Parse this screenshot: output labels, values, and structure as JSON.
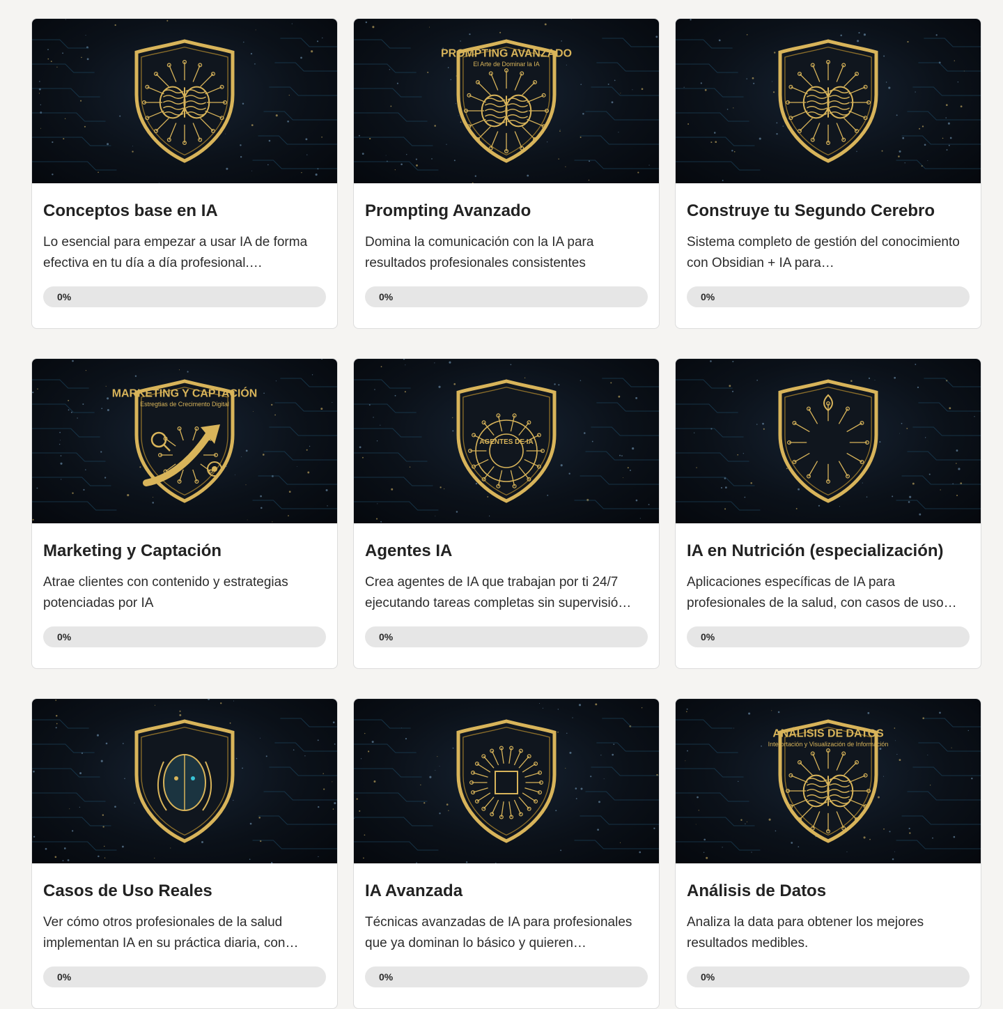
{
  "colors": {
    "accent": "#c9a54a",
    "badge_gold": "#d8b45a",
    "image_bg": "#0b1119",
    "progress_track": "#e6e6e6"
  },
  "courses": [
    {
      "title": "Conceptos base en IA",
      "description": "Lo esencial para empezar a usar IA de forma efectiva en tu día a día profesional.…",
      "progress_label": "0%",
      "progress": 0,
      "badge_text": "",
      "badge_subtext": "",
      "icon": "brain-circuit-shield-icon"
    },
    {
      "title": "Prompting Avanzado",
      "description": "Domina la comunicación con la IA para resultados profesionales consistentes",
      "progress_label": "0%",
      "progress": 0,
      "badge_text": "PROMPTING AVANZADO",
      "badge_subtext": "El Arte de Dominar la IA",
      "icon": "brain-cursor-shield-icon"
    },
    {
      "title": "Construye tu Segundo Cerebro",
      "description": "Sistema completo de gestión del conocimiento con Obsidian + IA para…",
      "progress_label": "0%",
      "progress": 0,
      "badge_text": "",
      "badge_subtext": "",
      "icon": "brain-shield-icon"
    },
    {
      "title": "Marketing y Captación",
      "description": "Atrae clientes con contenido y estrategias potenciadas por IA",
      "progress_label": "0%",
      "progress": 0,
      "badge_text": "MARKETING Y CAPTACIÓN",
      "badge_subtext": "Estregtias de Crecimento Digital",
      "icon": "growth-arrow-shield-icon"
    },
    {
      "title": "Agentes IA",
      "description": "Crea agentes de IA que trabajan por ti 24/7 ejecutando tareas completas sin supervisió…",
      "progress_label": "0%",
      "progress": 0,
      "badge_text": "AGENTES DE IA",
      "badge_subtext": "",
      "icon": "agents-circuit-shield-icon"
    },
    {
      "title": "IA en Nutrición (especialización)",
      "description": "Aplicaciones específicas de IA para profesionales de la salud, con casos de uso…",
      "progress_label": "0%",
      "progress": 0,
      "badge_text": "",
      "badge_subtext": "",
      "icon": "nutrition-circuit-shield-icon"
    },
    {
      "title": "Casos de Uso Reales",
      "description": "Ver cómo otros profesionales de la salud implementan IA en su práctica diaria, con…",
      "progress_label": "0%",
      "progress": 0,
      "badge_text": "",
      "badge_subtext": "",
      "icon": "face-circuit-shield-icon"
    },
    {
      "title": "IA Avanzada",
      "description": "Técnicas avanzadas de IA para profesionales que ya dominan lo básico y quieren…",
      "progress_label": "0%",
      "progress": 0,
      "badge_text": "",
      "badge_subtext": "",
      "icon": "chip-circuit-shield-icon"
    },
    {
      "title": "Análisis de Datos",
      "description": "Analiza la data para obtener los mejores resultados medibles.",
      "progress_label": "0%",
      "progress": 0,
      "badge_text": "ANÁLISIS DE DATOS",
      "badge_subtext": "Interprtación y Visualización de Información",
      "icon": "data-brain-shield-icon"
    }
  ]
}
